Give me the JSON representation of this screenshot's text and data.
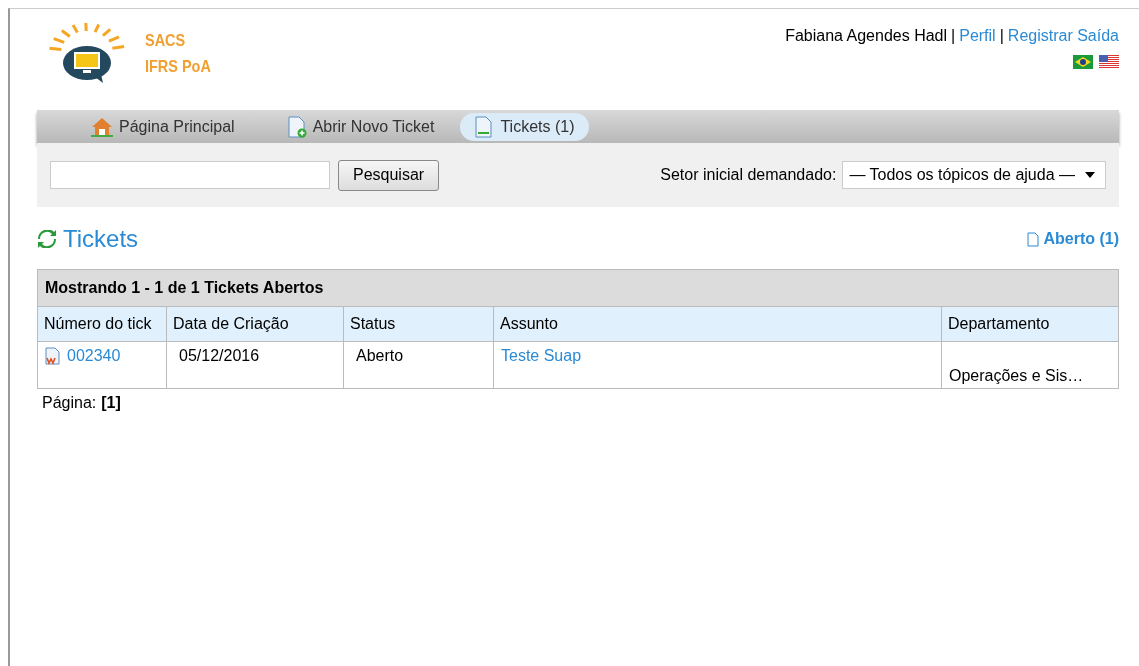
{
  "logo": {
    "line1": "SACS",
    "line2": "IFRS PoA"
  },
  "user_bar": {
    "name": "Fabiana Agendes Hadl",
    "separator_1": "|",
    "profile_link": "Perfil",
    "separator_2": "|",
    "logout_link": "Registrar Saída"
  },
  "nav_tabs": [
    {
      "label": "Página Principal",
      "kind": "home",
      "selected": false
    },
    {
      "label": "Abrir Novo Ticket",
      "kind": "new",
      "selected": false
    },
    {
      "label": "Tickets (1)",
      "kind": "doc",
      "selected": true
    }
  ],
  "search": {
    "button": "Pesquisar",
    "filter_label": "Setor inicial demandado:",
    "filter_value": "— Todos os tópicos de ajuda —"
  },
  "heading": {
    "title": "Tickets",
    "open_link": "Aberto (1)"
  },
  "table": {
    "caption": "Mostrando 1 - 1 de 1 Tickets Abertos",
    "columns": [
      "Número do tick",
      "Data de Criação",
      "Status",
      "Assunto",
      "Departamento"
    ],
    "rows": [
      {
        "number": "002340",
        "date": "05/12/2016",
        "status": "Aberto",
        "subject": "Teste Suap",
        "department": "Operações e Sis…"
      }
    ]
  },
  "pagination": {
    "label": "Página:",
    "current": "[1]"
  }
}
